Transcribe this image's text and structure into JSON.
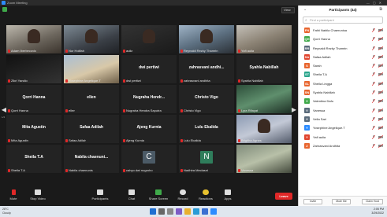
{
  "window": {
    "title": "Zoom Meeting"
  },
  "meeting": {
    "view_label": "View",
    "page_left": "1/4",
    "tiles": [
      {
        "name": "",
        "label": "Adam Iberbecovic",
        "style": "video1",
        "face": true
      },
      {
        "name": "",
        "label": "Nur Holifah",
        "style": "video2",
        "face": true
      },
      {
        "name": "",
        "label": "aulia",
        "style": "video3",
        "face": true
      },
      {
        "name": "",
        "label": "Reynaldi Rezky Thamrin",
        "style": "video4",
        "face": true
      },
      {
        "name": "",
        "label": "Yafi aulia",
        "style": "video5",
        "face": false
      },
      {
        "name": "",
        "label": "Zikri Yandio",
        "style": "video6",
        "face": false
      },
      {
        "name": "",
        "label": "Yosephine Angelique.T",
        "style": "video7",
        "face": false
      },
      {
        "name": "dwi pertiwi",
        "label": "dwi pertiwi",
        "style": "",
        "face": false
      },
      {
        "name": "zahrasvani andhi...",
        "label": "zahrasvani andhita",
        "style": "",
        "face": false
      },
      {
        "name": "Syahla Nabillah",
        "label": "Syahla Nabillah",
        "style": "",
        "face": false
      },
      {
        "name": "Qorri Hanna",
        "label": "Qorri Hanna",
        "style": "",
        "face": false
      },
      {
        "name": "ellen",
        "label": "ellen",
        "style": "",
        "face": false
      },
      {
        "name": "Nugraha Hendr...",
        "label": "Nugraha Hendra Saputra",
        "style": "",
        "face": false
      },
      {
        "name": "Christo Vigo",
        "label": "Christo Vigo",
        "style": "",
        "face": false
      },
      {
        "name": "",
        "label": "Lyra Rifayat",
        "style": "video8",
        "face": false
      },
      {
        "name": "Mita Agustin",
        "label": "Mita Agustin",
        "style": "",
        "face": false
      },
      {
        "name": "Safaa Adilah",
        "label": "Safaa Adilah",
        "style": "",
        "face": false
      },
      {
        "name": "Ajeng Kurnia",
        "label": "Ajeng Kurnia",
        "style": "",
        "face": false
      },
      {
        "name": "Lulu Ekalida",
        "label": "Lulu Ekalida",
        "style": "",
        "face": false
      },
      {
        "name": "",
        "label": "Brigitha Agnes",
        "style": "video9",
        "face": true
      },
      {
        "name": "Sheila T.A",
        "label": "Sheila T.A",
        "style": "",
        "face": false
      },
      {
        "name": "Nabila chaenuni...",
        "label": "Nabila chaenunis",
        "style": "",
        "face": false
      },
      {
        "name": "",
        "label": "cahyo dwi nugroho",
        "style": "avatarC",
        "face": false
      },
      {
        "name": "",
        "label": "Nadhira Meclasni",
        "style": "avatarN",
        "face": false
      },
      {
        "name": "",
        "label": "Vanessa",
        "style": "video10",
        "face": false
      }
    ],
    "avatar_c_letter": "C",
    "avatar_n_letter": "N"
  },
  "toolbar": {
    "mute": "Mute",
    "stop_video": "Stop Video",
    "participants": "Participants",
    "participants_count": "44",
    "chat": "Chat",
    "share_screen": "Share Screen",
    "record": "Record",
    "reactions": "Reactions",
    "apps": "Apps",
    "end": "Leave"
  },
  "panel": {
    "title": "Participants (44)",
    "search_placeholder": "Find a participant",
    "participants": [
      {
        "initials": "FN",
        "name": "Fathi Nabila Chaerunisa",
        "color": "#e8662f"
      },
      {
        "initials": "QH",
        "name": "Qorri Hanna",
        "color": "#3fa94a"
      },
      {
        "initials": "RR",
        "name": "Reynaldi Rezky Thamrin",
        "color": "#5a6b7b"
      },
      {
        "initials": "SA",
        "name": "Safaa Adilah",
        "color": "#e0452f"
      },
      {
        "initials": "S",
        "name": "Sarah",
        "color": "#e8662f"
      },
      {
        "initials": "ST",
        "name": "Sheila T.A",
        "color": "#2aa58c"
      },
      {
        "initials": "SL",
        "name": "Sheila Lingga",
        "color": "#e8662f"
      },
      {
        "initials": "SN",
        "name": "Syahla Nabillah",
        "color": "#e8662f"
      },
      {
        "initials": "V",
        "name": "Valentina Dafu",
        "color": "#3fa94a"
      },
      {
        "initials": "V",
        "name": "Vanessa",
        "color": "#5a6b7b"
      },
      {
        "initials": "V",
        "name": "Vella Sari",
        "color": "#5a6b7b"
      },
      {
        "initials": "Y",
        "name": "Yosephine Angelique.T",
        "color": "#2d8cff"
      },
      {
        "initials": "Y",
        "name": "Yafi aulia",
        "color": "#e0452f"
      },
      {
        "initials": "Z",
        "name": "Zahrasvani Andhita",
        "color": "#e8662f"
      }
    ],
    "invite": "Invite",
    "mute_me": "Mute Me",
    "claim_host": "Claim Host"
  },
  "taskbar": {
    "temp": "28°C",
    "weather": "Cloudy",
    "time": "2:05 PM",
    "date": "3/29/2022"
  }
}
